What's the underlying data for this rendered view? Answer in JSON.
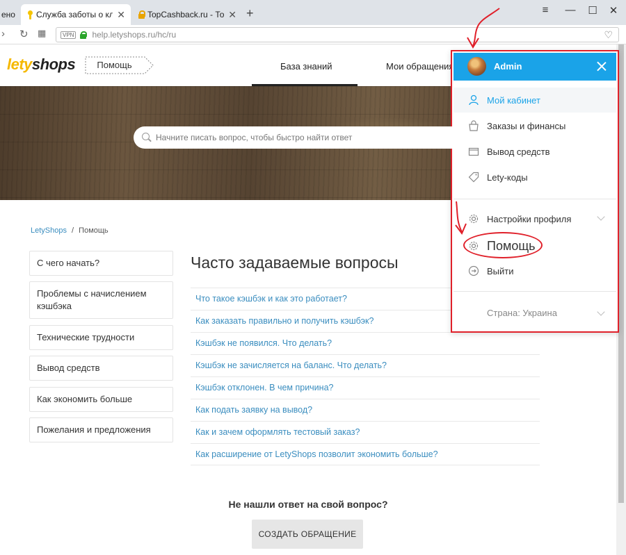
{
  "browser": {
    "tabs": [
      {
        "title": "ено"
      },
      {
        "title": "Служба заботы о клиента"
      },
      {
        "title": "TopCashback.ru - Топ лучш"
      }
    ],
    "url": "help.letyshops.ru/hc/ru",
    "vpn_label": "VPN"
  },
  "header": {
    "logo_part1": "lety",
    "logo_part2": "shops",
    "help_tag": "Помощь",
    "nav": [
      "База знаний",
      "Мои обращения"
    ]
  },
  "search": {
    "placeholder": "Начните писать вопрос, чтобы быстро найти ответ"
  },
  "breadcrumb": {
    "home": "LetyShops",
    "sep": "/",
    "current": "Помощь"
  },
  "categories": [
    "С чего начать?",
    "Проблемы с начислением кэшбэка",
    "Технические трудности",
    "Вывод средств",
    "Как экономить больше",
    "Пожелания и предложения"
  ],
  "faq": {
    "title": "Часто задаваемые вопросы",
    "items": [
      "Что такое кэшбэк и как это работает?",
      "Как заказать правильно и получить кэшбэк?",
      "Кэшбэк не появился. Что делать?",
      "Кэшбэк не зачисляется на баланс. Что делать?",
      "Кэшбэк отклонен. В чем причина?",
      "Как подать заявку на вывод?",
      "Как и зачем оформлять тестовый заказ?",
      "Как расширение от LetyShops позволит экономить больше?"
    ]
  },
  "footer": {
    "no_answer": "Не нашли ответ на свой вопрос?",
    "create_button": "СОЗДАТЬ ОБРАЩЕНИЕ"
  },
  "dropdown": {
    "user": "Admin",
    "items": [
      "Мой кабинет",
      "Заказы и финансы",
      "Вывод средств",
      "Lety-коды",
      "Настройки профиля",
      "Помощь",
      "Выйти"
    ],
    "country": "Страна: Украина",
    "accent_color": "#1aa3e8",
    "highlight_color": "#e0202a"
  }
}
